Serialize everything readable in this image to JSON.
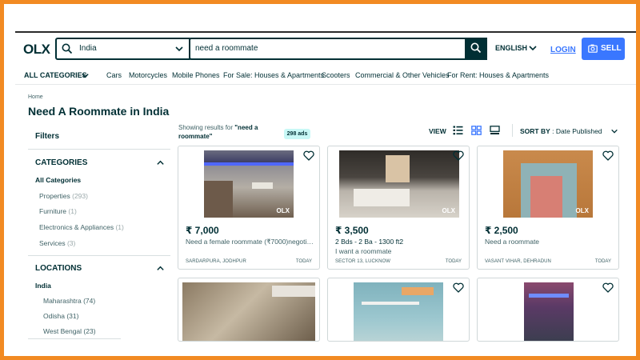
{
  "header": {
    "logo": "OLX",
    "location_value": "India",
    "search_value": "need a roommate",
    "language": "ENGLISH",
    "login": "LOGIN",
    "sell": "SELL"
  },
  "category_nav": {
    "all_categories": "ALL CATEGORIES",
    "links": [
      "Cars",
      "Motorcycles",
      "Mobile Phones",
      "For Sale: Houses & Apartments",
      "Scooters",
      "Commercial & Other Vehicles",
      "For Rent: Houses & Apartments"
    ]
  },
  "page": {
    "breadcrumb": "Home",
    "title": "Need A Roommate in India"
  },
  "filters": {
    "heading": "Filters",
    "categories": {
      "title": "CATEGORIES",
      "all": "All Categories",
      "items": [
        {
          "label": "Properties",
          "count": "(293)"
        },
        {
          "label": "Furniture",
          "count": "(1)"
        },
        {
          "label": "Electronics & Appliances",
          "count": "(1)"
        },
        {
          "label": "Services",
          "count": "(3)"
        }
      ]
    },
    "locations": {
      "title": "LOCATIONS",
      "selected": "India",
      "items": [
        {
          "label": "Maharashtra",
          "count": "(74)"
        },
        {
          "label": "Odisha",
          "count": "(31)"
        },
        {
          "label": "West Bengal",
          "count": "(23)"
        }
      ]
    }
  },
  "results": {
    "showing_prefix": "Showing results for",
    "query": "\"need a roommate\"",
    "ads_count": "298 ads",
    "view_label": "VIEW",
    "sort_label": "SORT BY",
    "sort_value": ": Date Published"
  },
  "listings": [
    {
      "price": "₹ 7,000",
      "desc": "Need a female roommate (₹7000)negotia...",
      "desc2": "",
      "place": "SARDARPURA, JODHPUR",
      "date": "TODAY"
    },
    {
      "price": "₹ 3,500",
      "desc": "2 Bds - 2 Ba - 1300 ft2",
      "desc2": "I want a roommate",
      "place": "SECTOR 13, LUCKNOW",
      "date": "TODAY"
    },
    {
      "price": "₹ 2,500",
      "desc": "Need a roommate",
      "desc2": "",
      "place": "VASANT VIHAR, DEHRADUN",
      "date": "TODAY"
    }
  ],
  "colors": {
    "frame": "#f28a22",
    "brand_dark": "#002f34",
    "accent_blue": "#3a77ff",
    "badge_bg": "#c8f8f6"
  },
  "icons": [
    "search-icon",
    "chevron-down-icon",
    "camera-plus-icon",
    "heart-icon",
    "list-view-icon",
    "grid-view-icon",
    "gallery-view-icon",
    "chevron-up-icon"
  ]
}
